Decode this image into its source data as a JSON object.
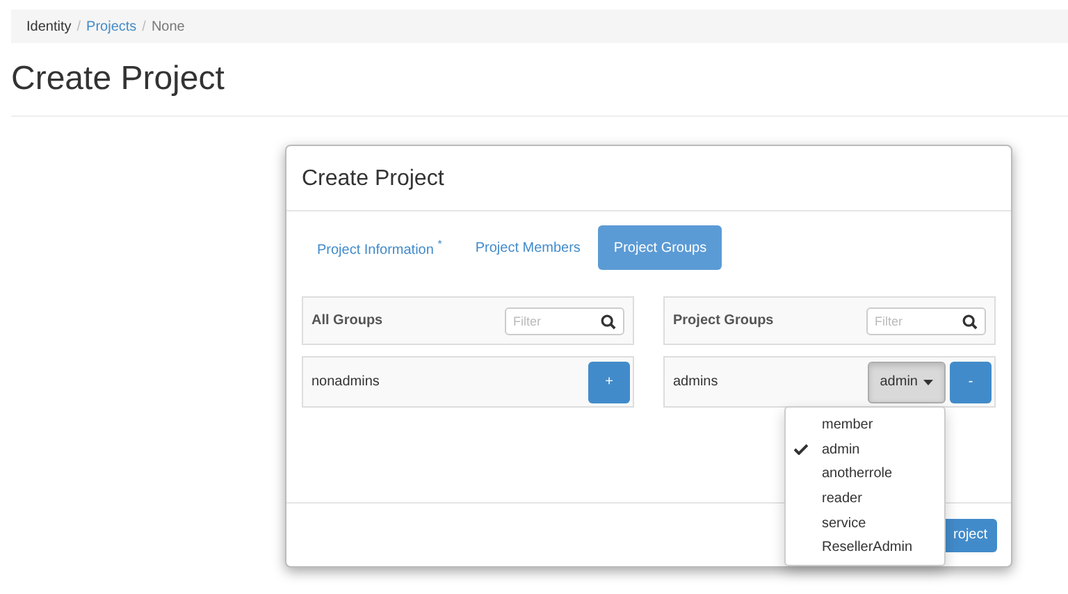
{
  "breadcrumb": [
    {
      "label": "Identity",
      "kind": "text",
      "separator": "/"
    },
    {
      "label": "Projects",
      "kind": "link",
      "separator": "/"
    },
    {
      "label": "None",
      "kind": "current"
    }
  ],
  "page_title": "Create Project",
  "modal": {
    "title": "Create Project",
    "tabs": [
      {
        "label": "Project Information",
        "marker": "*",
        "selected": false
      },
      {
        "label": "Project Members",
        "selected": false
      },
      {
        "label": "Project Groups",
        "selected": true
      }
    ],
    "all_groups": {
      "title": "All Groups",
      "placeholder": "Filter",
      "rows": [
        {
          "name": "nonadmins",
          "action": "+"
        }
      ]
    },
    "project_groups": {
      "title": "Project Groups",
      "placeholder": "Filter",
      "rows": [
        {
          "name": "admins",
          "role": "admin",
          "action": "-",
          "expanded": true,
          "role_options": [
            {
              "label": "member",
              "selected": false
            },
            {
              "label": "admin",
              "selected": true
            },
            {
              "label": "anotherrole",
              "selected": false
            },
            {
              "label": "reader",
              "selected": false
            },
            {
              "label": "service",
              "selected": false
            },
            {
              "label": "ResellerAdmin",
              "selected": false
            }
          ]
        }
      ]
    },
    "footer_button": "roject"
  }
}
